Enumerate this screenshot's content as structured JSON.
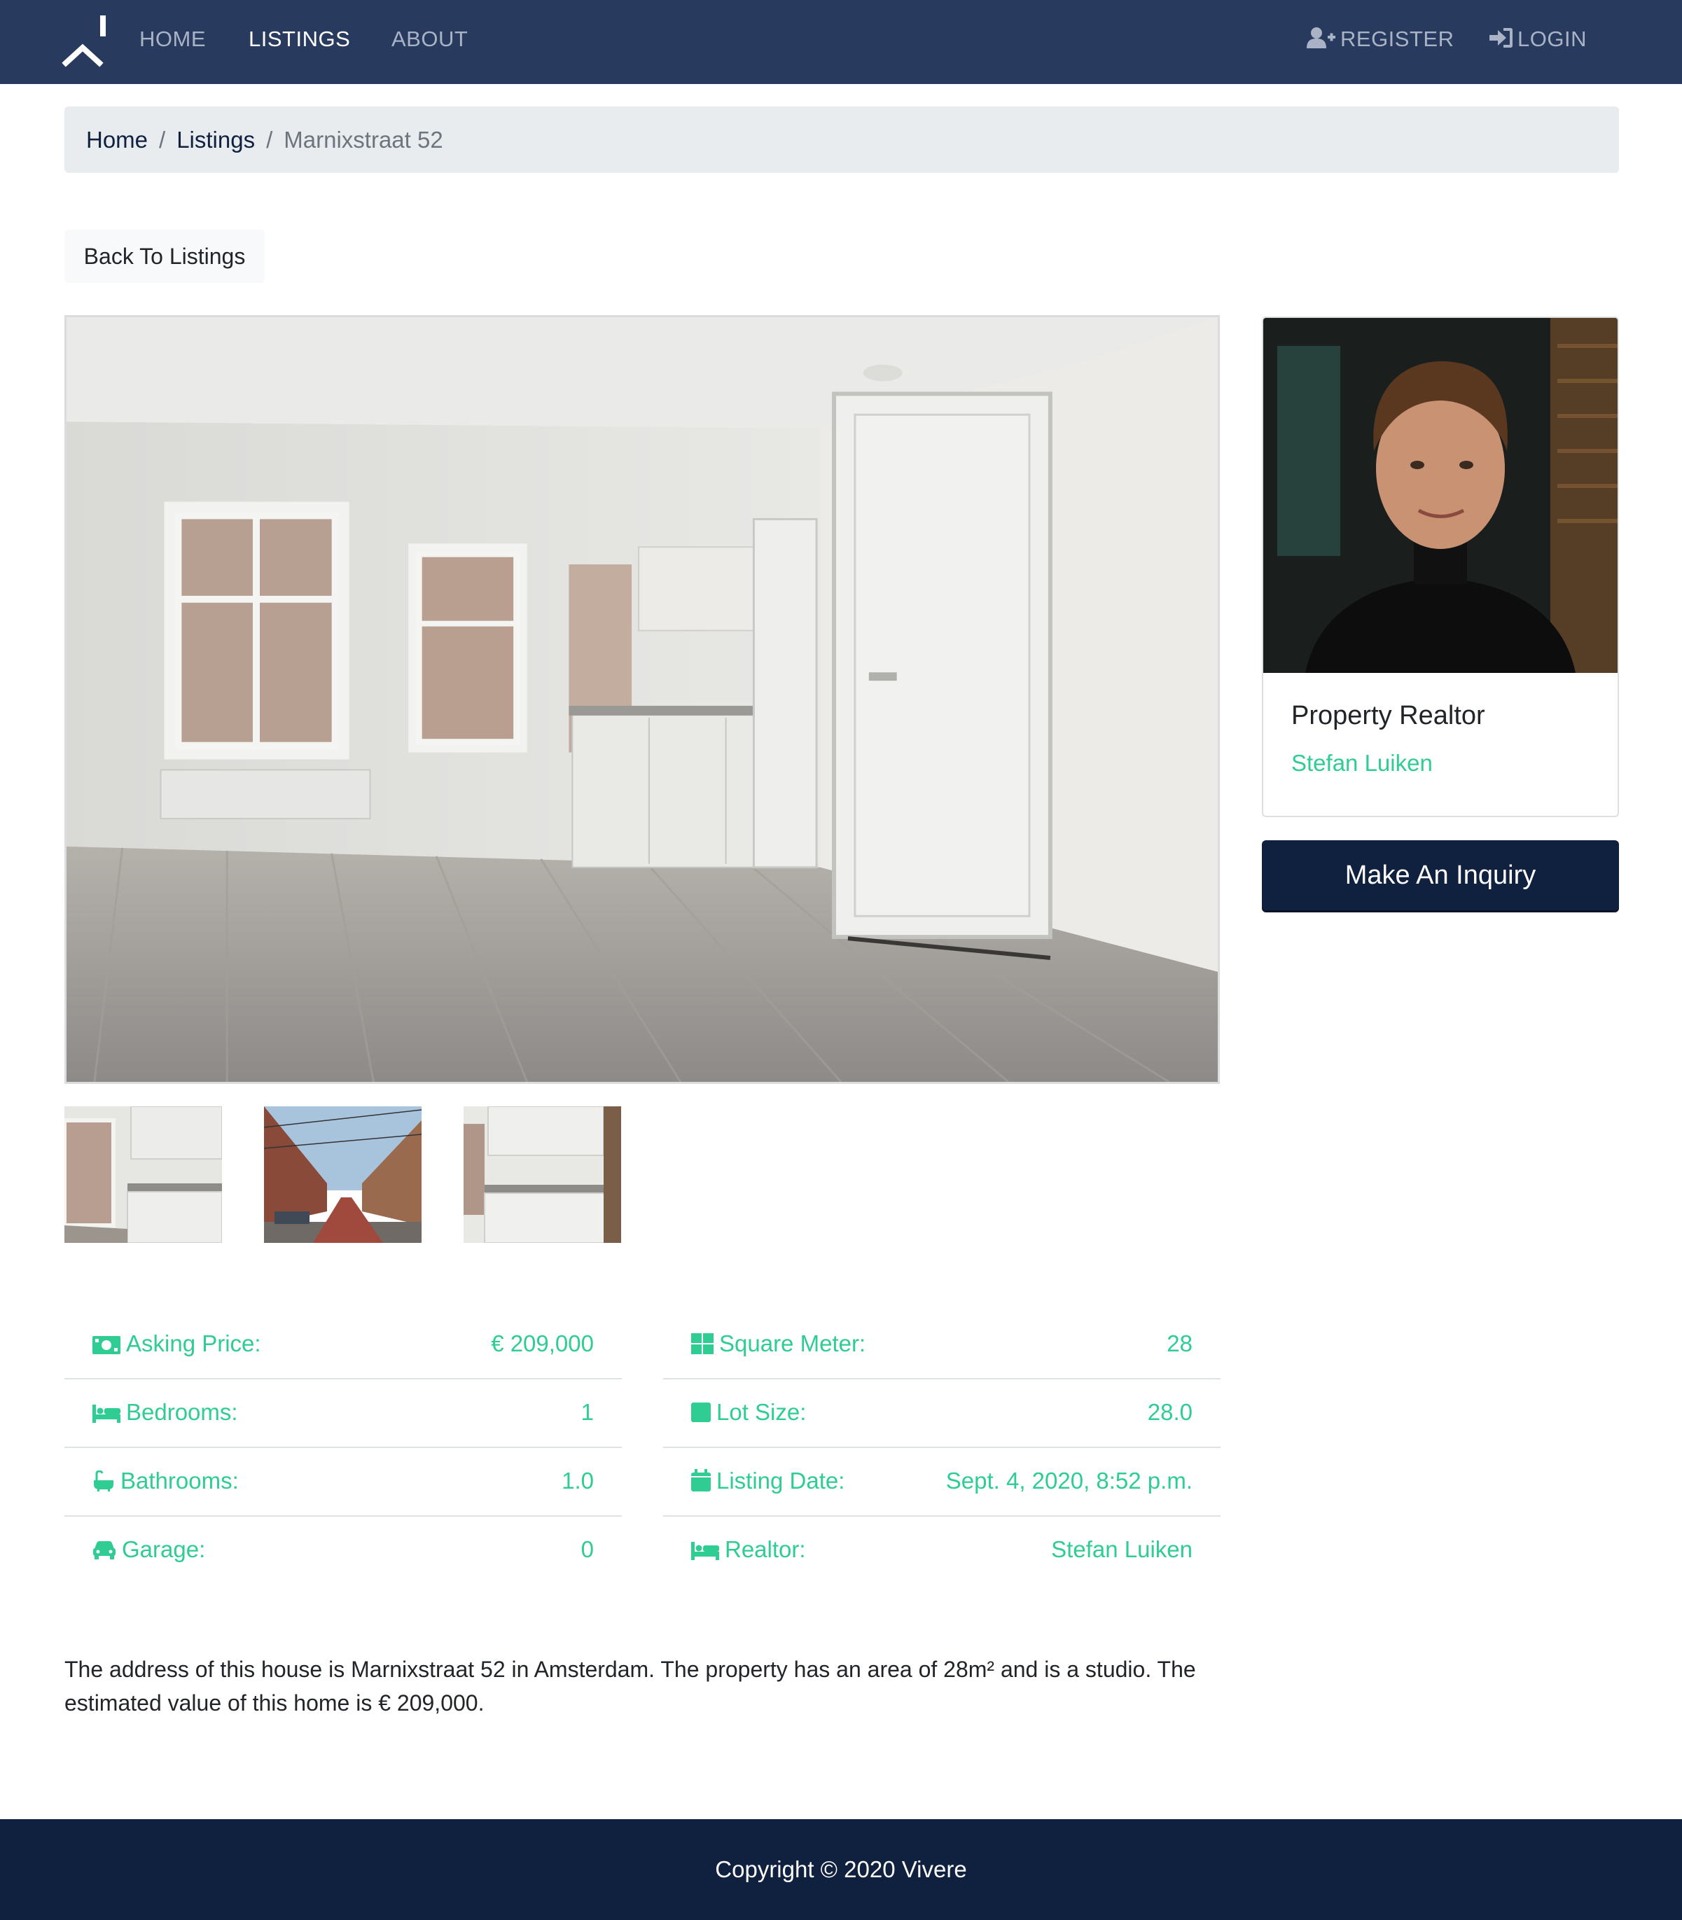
{
  "nav": {
    "links": [
      {
        "label": "HOME",
        "active": false
      },
      {
        "label": "LISTINGS",
        "active": true
      },
      {
        "label": "ABOUT",
        "active": false
      }
    ],
    "register": "REGISTER",
    "login": "LOGIN"
  },
  "breadcrumb": {
    "home": "Home",
    "separator": "/",
    "listings": "Listings",
    "current": "Marnixstraat 52"
  },
  "back_button": "Back To Listings",
  "realtor": {
    "title": "Property Realtor",
    "name": "Stefan Luiken",
    "inquiry_button": "Make An Inquiry"
  },
  "details": {
    "left": [
      {
        "icon": "money-icon",
        "label": "Asking Price:",
        "value": "€ 209,000"
      },
      {
        "icon": "bed-icon",
        "label": "Bedrooms:",
        "value": "1"
      },
      {
        "icon": "bath-icon",
        "label": "Bathrooms:",
        "value": "1.0"
      },
      {
        "icon": "car-icon",
        "label": "Garage:",
        "value": "0"
      }
    ],
    "right": [
      {
        "icon": "grid-icon",
        "label": "Square Meter:",
        "value": "28"
      },
      {
        "icon": "square-icon",
        "label": "Lot Size:",
        "value": "28.0"
      },
      {
        "icon": "calendar-icon",
        "label": "Listing Date:",
        "value": "Sept. 4, 2020, 8:52 p.m."
      },
      {
        "icon": "bed-icon",
        "label": "Realtor:",
        "value": "Stefan Luiken"
      }
    ]
  },
  "description": "The address of this house is Marnixstraat 52 in Amsterdam. The property has an area of 28m² and is a studio. The estimated value of this home is € 209,000.",
  "footer": "Copyright © 2020 Vivere",
  "colors": {
    "navbar": "#283b5e",
    "dark_navy": "#10203f",
    "accent_green": "#2fcc93"
  }
}
